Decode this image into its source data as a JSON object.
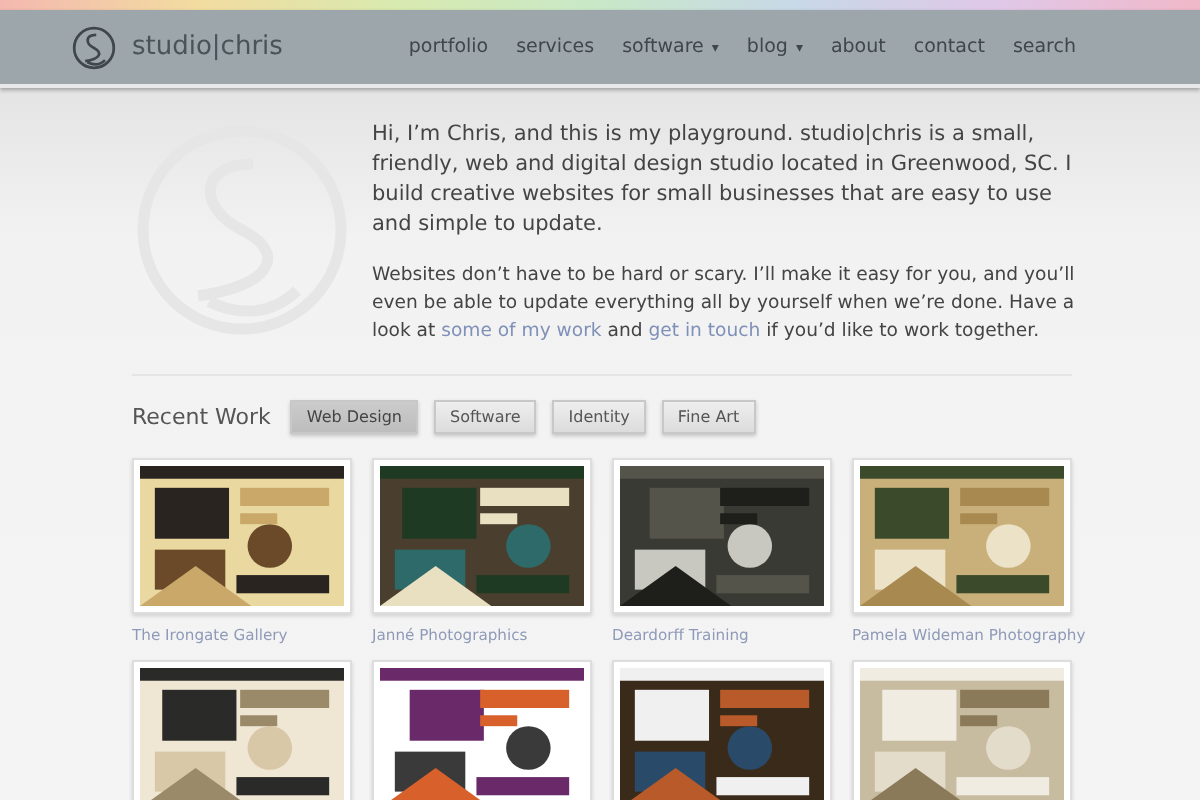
{
  "header": {
    "logo_text": "studio|chris",
    "nav": [
      {
        "label": "portfolio",
        "kind": "link"
      },
      {
        "label": "services",
        "kind": "link"
      },
      {
        "label": "software",
        "kind": "dropdown",
        "caret": "▾"
      },
      {
        "label": "blog",
        "kind": "dropdown",
        "caret": "▾"
      },
      {
        "label": "about",
        "kind": "link"
      },
      {
        "label": "contact",
        "kind": "link"
      },
      {
        "label": "search",
        "kind": "link"
      }
    ]
  },
  "intro": {
    "lead": "Hi, I’m Chris, and this is my playground. studio|chris is a small, friendly, web and digital design studio located in Greenwood, SC. I build creative websites for small businesses that are easy to use and simple to update.",
    "body": [
      {
        "kind": "text",
        "text": "Websites don’t have to be hard or scary. I’ll make it easy for you, and you’ll even be able to update everything all by yourself when we’re done. Have a look at "
      },
      {
        "kind": "link",
        "text": "some of my work"
      },
      {
        "kind": "text",
        "text": " and "
      },
      {
        "kind": "link",
        "text": "get in touch"
      },
      {
        "kind": "text",
        "text": " if you’d like to work together."
      }
    ]
  },
  "recent_work": {
    "title": "Recent Work",
    "filters": [
      {
        "label": "Web Design",
        "selected": true
      },
      {
        "label": "Software",
        "selected": false
      },
      {
        "label": "Identity",
        "selected": false
      },
      {
        "label": "Fine Art",
        "selected": false
      }
    ],
    "items": [
      {
        "kind": "picture",
        "caption": "The Irongate Gallery"
      },
      {
        "kind": "picture",
        "caption": "Janné Photographics"
      },
      {
        "kind": "picture",
        "caption": "Deardorff Training"
      },
      {
        "kind": "picture",
        "caption": "Pamela Wideman Photography"
      },
      {
        "kind": "picture"
      },
      {
        "kind": "picture"
      },
      {
        "kind": "picture"
      },
      {
        "kind": "picture"
      }
    ]
  }
}
